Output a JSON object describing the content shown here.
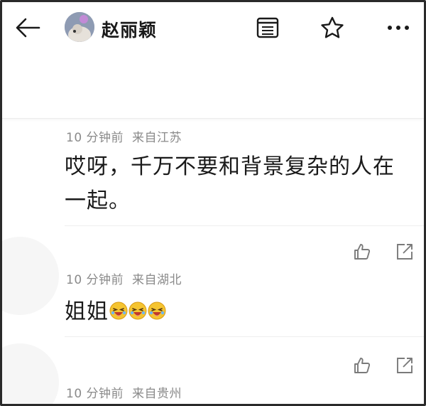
{
  "header": {
    "user_name": "赵丽颖",
    "icons": [
      "back-arrow-icon",
      "avatar",
      "document-icon",
      "star-icon",
      "more-icon"
    ]
  },
  "comments": [
    {
      "time": "10 分钟前",
      "location": "来自江苏",
      "text_line1": "哎呀，千万不要和背景复杂的人在",
      "text_line2": "一起。"
    },
    {
      "time": "10 分钟前",
      "location": "来自湖北",
      "text": "姐姐",
      "emoji_count": 3,
      "emoji": "laughing-face-emoji"
    },
    {
      "time": "10 分钟前",
      "location": "来自贵州"
    }
  ],
  "actions": [
    "like-icon",
    "share-icon"
  ],
  "colors": {
    "text": "#1a1a1a",
    "meta": "#8a8a8a",
    "emoji": "#f5c430"
  }
}
